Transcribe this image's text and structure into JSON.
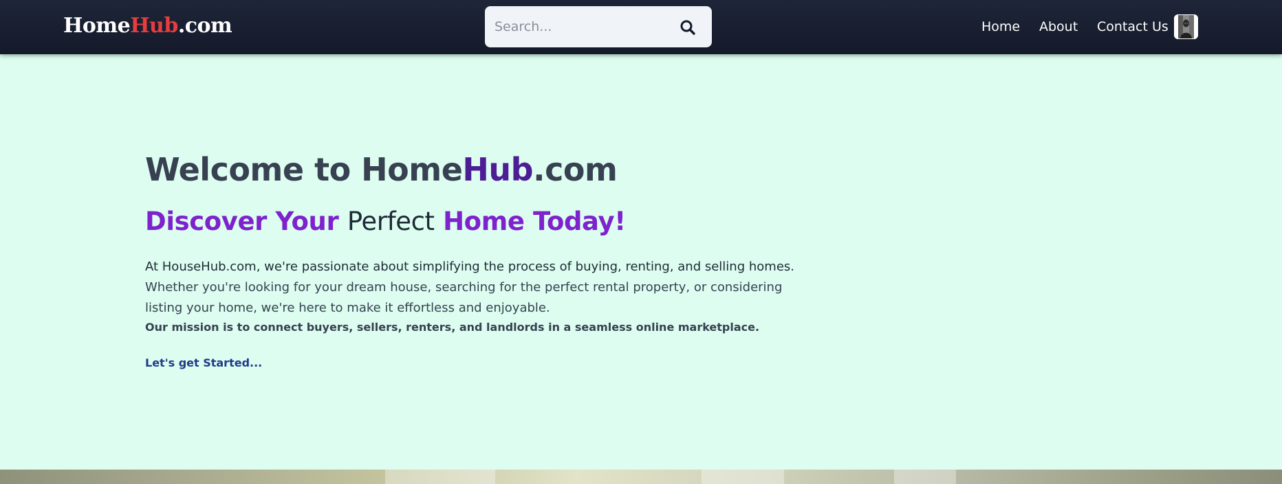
{
  "brand": {
    "part1": "Home",
    "part2": "Hub",
    "part3": ".com"
  },
  "search": {
    "placeholder": "Search..."
  },
  "nav": {
    "home": "Home",
    "about": "About",
    "contact": "Contact Us"
  },
  "hero": {
    "title_prefix": "Welcome to Home",
    "title_hub": "Hub",
    "title_suffix": ".com",
    "subtitle_part1": "Discover Your",
    "subtitle_part2": "Perfect",
    "subtitle_part3": "Home Today!",
    "paragraph_line1": "At HouseHub.com, we're passionate about simplifying the process of buying, renting, and selling homes.",
    "paragraph_line2": "Whether you're looking for your dream house, searching for the perfect rental property, or considering listing your home, we're here to make it effortless and enjoyable.",
    "mission": "Our mission is to connect buyers, sellers, renters, and landlords in a seamless online marketplace.",
    "cta": "Let's get Started..."
  },
  "colors": {
    "navbar_bg": "#161c2d",
    "page_bg": "#dcfdef",
    "brand_accent": "#e53e3e",
    "hub_accent": "#4c1d95",
    "subtitle_purple": "#7e22ce",
    "cta_blue": "#1e3a8a"
  },
  "icons": {
    "search": "search-icon",
    "avatar": "user-avatar"
  }
}
